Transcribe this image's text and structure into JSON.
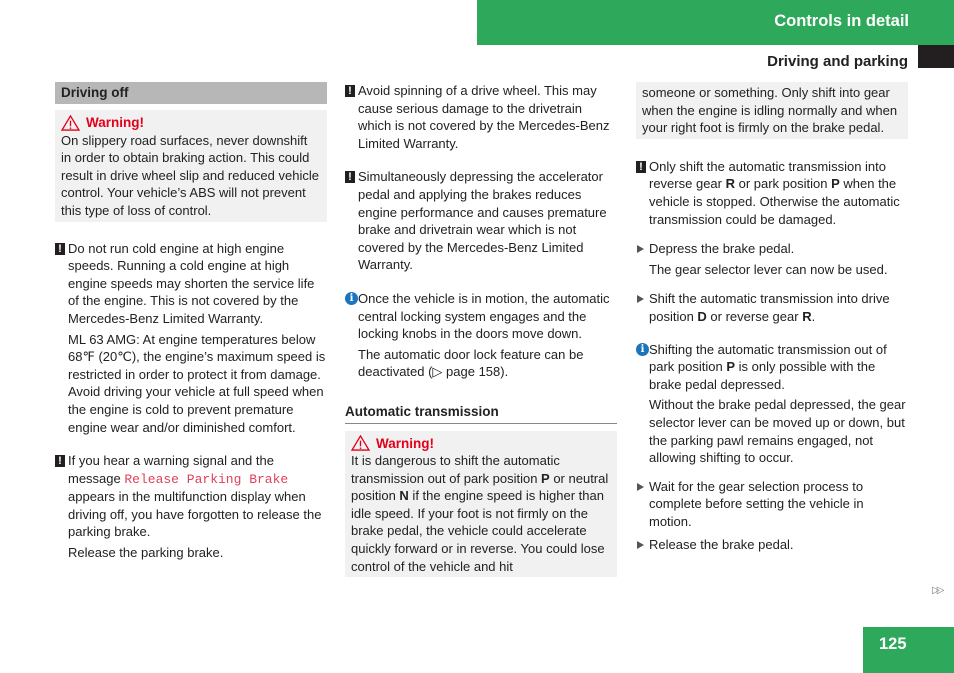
{
  "header": {
    "chapter": "Controls in detail",
    "section": "Driving and parking",
    "accent_color": "#2ea85a"
  },
  "col1": {
    "section_title": "Driving off",
    "warning": {
      "title": "Warning!",
      "text": "On slippery road surfaces, never downshift in order to obtain braking action. This could result in drive wheel slip and reduced vehicle control. Your vehicle’s ABS will not prevent this type of loss of control."
    },
    "note1": {
      "text": "Do not run cold engine at high engine speeds. Running a cold engine at high engine speeds may shorten the service life of the engine. This is not covered by the Mercedes-Benz Limited Warranty.",
      "extra": "ML 63 AMG: At engine temperatures below 68℉ (20℃), the engine’s maximum speed is restricted in order to protect it from damage. Avoid driving your vehicle at full speed when the engine is cold to prevent premature engine wear and/or diminished comfort."
    },
    "note2": {
      "text_before": "If you hear a warning signal and the message ",
      "message": "Release Parking Brake",
      "text_after": " appears in the multifunction display when driving off, you have forgotten to release the parking brake.",
      "extra": "Release the parking brake."
    }
  },
  "col2": {
    "note1": "Avoid spinning of a drive wheel. This may cause serious damage to the drivetrain which is not covered by the Mercedes-Benz Limited Warranty.",
    "note2": "Simultaneously depressing the accelerator pedal and applying the brakes reduces engine performance and causes premature brake and drivetrain wear which is not covered by the Mercedes-Benz Limited Warranty.",
    "info1": {
      "text": "Once the vehicle is in motion, the automatic central locking system engages and the locking knobs in the doors move down.",
      "extra": "The automatic door lock feature can be deactivated (▷ page 158)."
    },
    "subsection_title": "Automatic transmission",
    "warning": {
      "title": "Warning!",
      "t1": "It is dangerous to shift the automatic transmission out of park position ",
      "b1": "P",
      "t2": " or neutral position ",
      "b2": "N",
      "t3": " if the engine speed is higher than idle speed. If your foot is not firmly on the brake pedal, the vehicle could accelerate quickly forward or in reverse. You could lose control of the vehicle and hit"
    }
  },
  "col3": {
    "warning_cont": "someone or something. Only shift into gear when the engine is idling normally and when your right foot is firmly on the brake pedal.",
    "note1": {
      "t1": "Only shift the automatic transmission into reverse gear ",
      "b1": "R",
      "t2": " or park position ",
      "b2": "P",
      "t3": " when the vehicle is stopped. Otherwise the automatic transmission could be damaged."
    },
    "step1": {
      "text": "Depress the brake pedal.",
      "extra": "The gear selector lever can now be used."
    },
    "step2": {
      "t1": "Shift the automatic transmission into drive position ",
      "b1": "D",
      "t2": " or reverse gear ",
      "b2": "R",
      "t3": "."
    },
    "info1": {
      "t1": "Shifting the automatic transmission out of park position ",
      "b1": "P",
      "t2": " is only possible with the brake pedal depressed.",
      "extra": "Without the brake pedal depressed, the gear selector lever can be moved up or down, but the parking pawl remains engaged, not allowing shifting to occur."
    },
    "step3": "Wait for the gear selection process to complete before setting the vehicle in motion.",
    "step4": "Release the brake pedal."
  },
  "footer": {
    "continue_symbol": "▷▷",
    "page_number": "125"
  },
  "icons": {
    "note": "!",
    "info": "i"
  }
}
